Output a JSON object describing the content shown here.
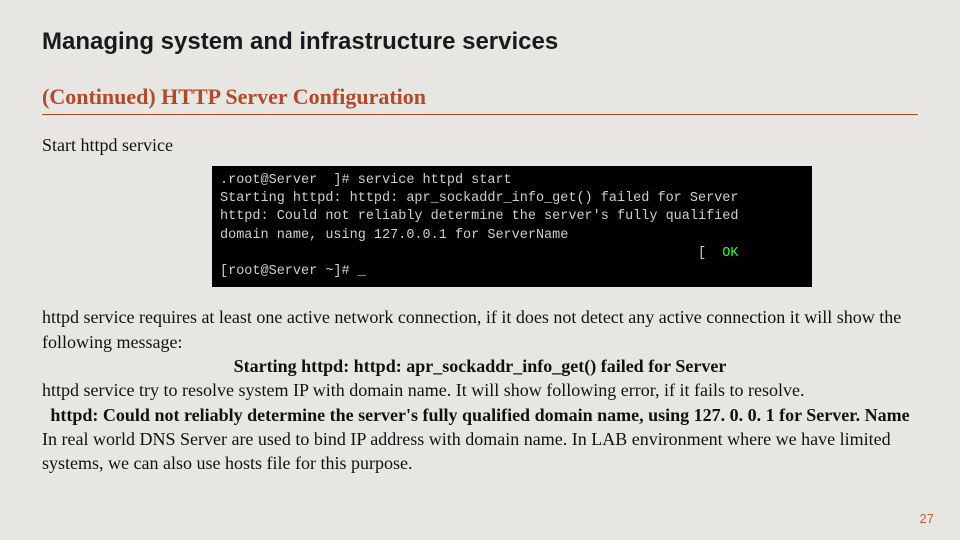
{
  "slide": {
    "title": "Managing system and infrastructure services",
    "subheading": "(Continued) HTTP Server Configuration",
    "intro": "Start httpd service",
    "terminal": {
      "line1": ".root@Server  ]# service httpd start",
      "line2": "Starting httpd: httpd: apr_sockaddr_info_get() failed for Server",
      "line3": "httpd: Could not reliably determine the server's fully qualified",
      "line4": "domain name, using 127.0.0.1 for ServerName",
      "line5_open": "                                                           [  ",
      "line5_ok": "OK",
      "line5_close": "",
      "line6": "[root@Server ~]# _"
    },
    "para1": "httpd service requires at least one active network connection, if it does not detect any active connection it will show the following message:",
    "bold1": "Starting httpd: httpd: apr_sockaddr_info_get() failed for Server",
    "para2": "httpd service try to resolve system IP with domain name. It will show following error, if it fails to resolve.",
    "bold2": "httpd: Could not reliably determine the server's fully qualified domain name, using 127. 0. 0. 1 for Server. Name",
    "para3": "In real world DNS Server are used to bind IP address with domain name. In LAB environment where we have limited systems, we can also use hosts file for this purpose.",
    "page_number": "27"
  }
}
